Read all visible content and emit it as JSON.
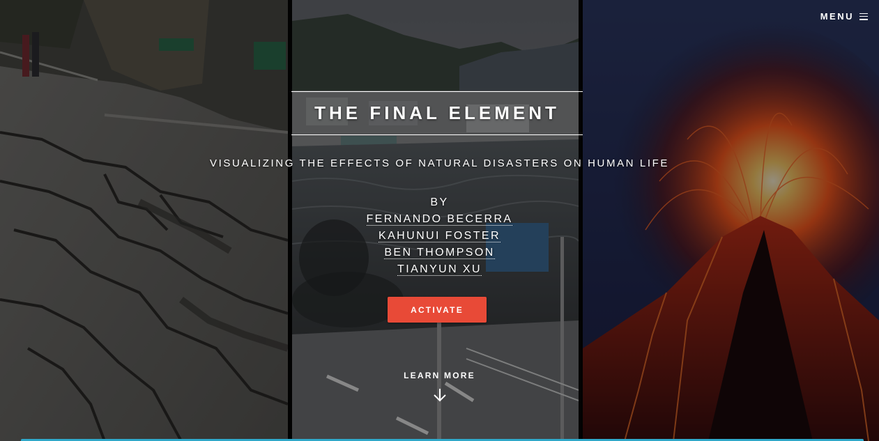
{
  "menu": {
    "label": "MENU",
    "icon": "hamburger-icon"
  },
  "hero": {
    "title": "THE FINAL ELEMENT",
    "subtitle": "VISUALIZING THE EFFECTS OF NATURAL DISASTERS ON HUMAN LIFE",
    "by_label": "BY",
    "authors": [
      "FERNANDO BECERRA",
      "KAHUNUI FOSTER",
      "BEN THOMPSON",
      "TIANYUN XU"
    ],
    "activate_label": "ACTIVATE",
    "learn_more_label": "LEARN MORE",
    "learn_more_icon": "arrow-down-icon"
  },
  "panels": [
    {
      "name": "earthquake-photo"
    },
    {
      "name": "tsunami-photo"
    },
    {
      "name": "volcano-photo"
    }
  ],
  "colors": {
    "accent": "#e84a37",
    "bottom_bar": "#2fa8c9",
    "text": "#ffffff"
  }
}
